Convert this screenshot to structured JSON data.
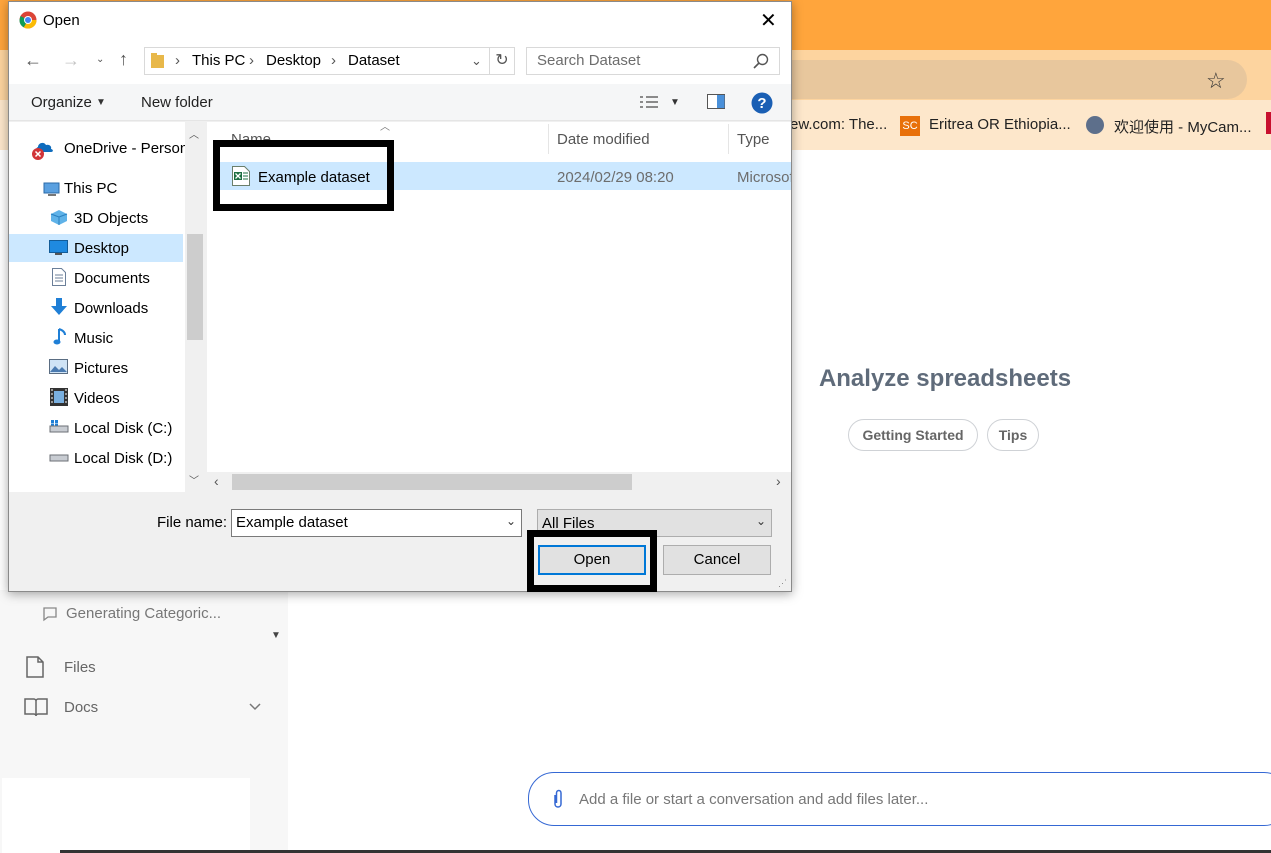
{
  "browser": {
    "bookmarks": [
      {
        "label": "ew.com: The..."
      },
      {
        "label": "Eritrea OR Ethiopia...",
        "badge": "SC"
      },
      {
        "label": "欢迎使用 - MyCam..."
      }
    ]
  },
  "app": {
    "hero_title": "Analyze spreadsheets",
    "pills": [
      "Getting Started",
      "Tips"
    ],
    "sidebar": {
      "conversation": "Generating Categoric...",
      "files": "Files",
      "docs": "Docs"
    },
    "chat_placeholder": "Add a file or start a conversation and add files later..."
  },
  "dialog": {
    "title": "Open",
    "breadcrumb": [
      "This PC",
      "Desktop",
      "Dataset"
    ],
    "search_placeholder": "Search Dataset",
    "toolbar": {
      "organize": "Organize",
      "new_folder": "New folder"
    },
    "nav_tree": [
      "OneDrive - Person",
      "This PC",
      "3D Objects",
      "Desktop",
      "Documents",
      "Downloads",
      "Music",
      "Pictures",
      "Videos",
      "Local Disk (C:)",
      "Local Disk (D:)"
    ],
    "selected_nav": "Desktop",
    "columns": {
      "name": "Name",
      "date": "Date modified",
      "type": "Type"
    },
    "files": [
      {
        "name": "Example dataset",
        "date": "2024/02/29 08:20",
        "type": "Microsof"
      }
    ],
    "file_name_label": "File name:",
    "file_name_value": "Example dataset",
    "file_type": "All Files",
    "open_label": "Open",
    "cancel_label": "Cancel"
  },
  "colors": {
    "browser_orange": "#ffa53c",
    "selection": "#cce8ff",
    "highlight": "#000000"
  }
}
